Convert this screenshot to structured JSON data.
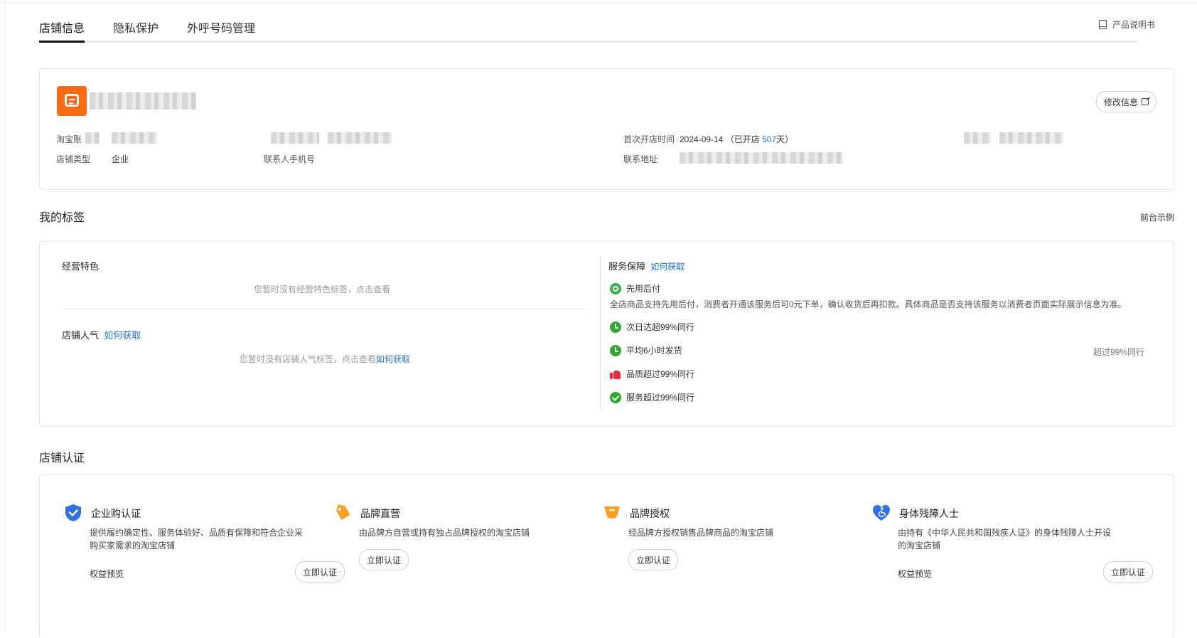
{
  "tabs": [
    "店铺信息",
    "隐私保护",
    "外呼号码管理"
  ],
  "manual_link": "产品说明书",
  "info": {
    "edit_button": "修改信息",
    "taobao_account_label": "淘宝账",
    "first_open_label": "首次开店时间",
    "first_open_date": "2024-09-14",
    "open_days_prefix": "（已开店",
    "open_days": "507",
    "open_days_suffix": "天）",
    "shop_type_label": "店铺类型",
    "shop_type_value": "企业",
    "contact_phone_label": "联系人手机号",
    "address_label": "联系地址"
  },
  "tags": {
    "section_title": "我的标签",
    "front_example": "前台示例",
    "business_feature": {
      "title": "经营特色",
      "empty_tip": "您暂时没有经营特色标签，点击查看"
    },
    "popularity": {
      "title": "店铺人气",
      "how_to": "如何获取",
      "empty_tip": "您暂时没有店铺人气标签，点击查看",
      "empty_tip_link": "如何获取"
    },
    "service": {
      "title": "服务保障",
      "how_to": "如何获取",
      "items": [
        {
          "icon": "badge-icon",
          "label": "先用后付",
          "desc": "全店商品支持先用后付，消费者开通该服务后可0元下单，确认收货后再扣款。具体商品是否支持该服务以消费者页面实际展示信息为准。"
        },
        {
          "icon": "clock-icon",
          "label": "次日达超99%同行"
        },
        {
          "icon": "clock-icon",
          "label": "平均6小时发货",
          "right": "超过99%同行"
        },
        {
          "icon": "thumbs-up-icon",
          "label": "品质超过99%同行"
        },
        {
          "icon": "check-icon",
          "label": "服务超过99%同行"
        }
      ]
    }
  },
  "cert": {
    "section_title": "店铺认证",
    "items": [
      {
        "icon": "shield-check-icon",
        "title": "企业购认证",
        "desc": "提供履约确定性、服务体验好、品质有保障和符合企业采购买家需求的淘宝店铺",
        "link": "权益预览",
        "button": "立即认证"
      },
      {
        "icon": "brand-tag-icon",
        "title": "品牌直营",
        "desc": "由品牌方自营或持有独占品牌授权的淘宝店铺",
        "button": "立即认证"
      },
      {
        "icon": "brand-auth-icon",
        "title": "品牌授权",
        "desc": "经品牌方授权销售品牌商品的淘宝店铺",
        "button": "立即认证"
      },
      {
        "icon": "accessibility-heart-icon",
        "title": "身体残障人士",
        "desc": "由持有《中华人民共和国残疾人证》的身体残障人士开设的淘宝店铺",
        "link": "权益预览",
        "button": "立即认证"
      }
    ]
  },
  "colors": {
    "accent": "#1f6fe5",
    "logo": "#ff6a13",
    "green": "#2fa832",
    "red": "#ee2b3a",
    "orange": "#f5a022",
    "shield_blue": "#2f6fe8"
  }
}
